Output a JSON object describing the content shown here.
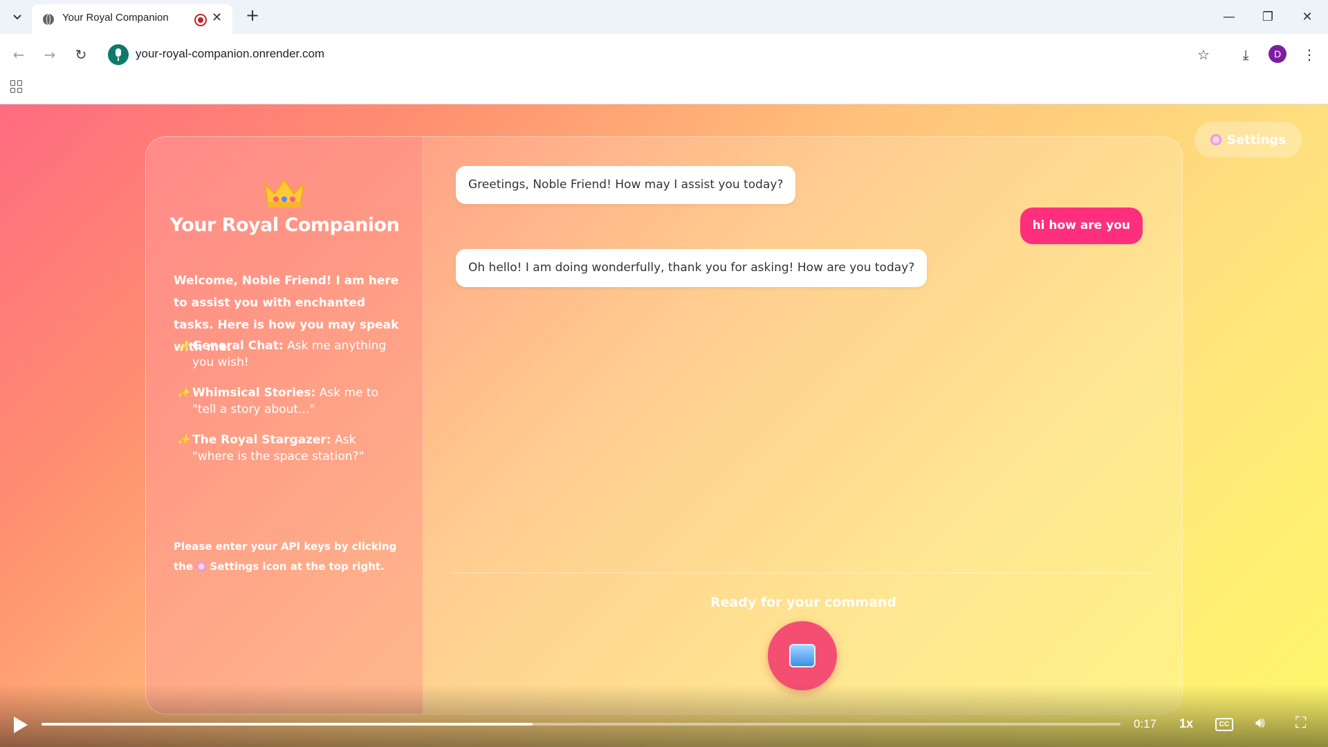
{
  "browser": {
    "tab_title": "Your Royal Companion",
    "url": "your-royal-companion.onrender.com",
    "avatar_initial": "D"
  },
  "app": {
    "settings_label": "Settings",
    "title": "Your Royal Companion",
    "intro": "Welcome, Noble Friend! I am here to assist you with enchanted tasks. Here is how you may speak with me:",
    "features": [
      {
        "name": "General Chat:",
        "desc": "Ask me anything you wish!"
      },
      {
        "name": "Whimsical Stories:",
        "desc": "Ask me to \"tell a story about...\""
      },
      {
        "name": "The Royal Stargazer:",
        "desc": "Ask \"where is the space station?\""
      }
    ],
    "note_before": "Please enter your API keys by clicking the",
    "note_settings": "Settings",
    "note_after": "icon at the top right.",
    "messages": [
      {
        "role": "bot",
        "text": "Greetings, Noble Friend! How may I assist you today?"
      },
      {
        "role": "user",
        "text": "hi how are you"
      },
      {
        "role": "bot",
        "text": "Oh hello! I am doing wonderfully, thank you for asking! How are you today?"
      }
    ],
    "status": "Ready for your command"
  },
  "video": {
    "time": "0:17",
    "speed": "1x",
    "cc": "CC",
    "progress_fraction": 0.455
  },
  "icons": {
    "gear": "gear-icon",
    "crown": "crown-icon",
    "sparkle": "sparkle-icon",
    "mic": "microphone-icon"
  },
  "colors": {
    "user_bubble": "#ff2f7d",
    "mic_button": "#f44e73"
  }
}
